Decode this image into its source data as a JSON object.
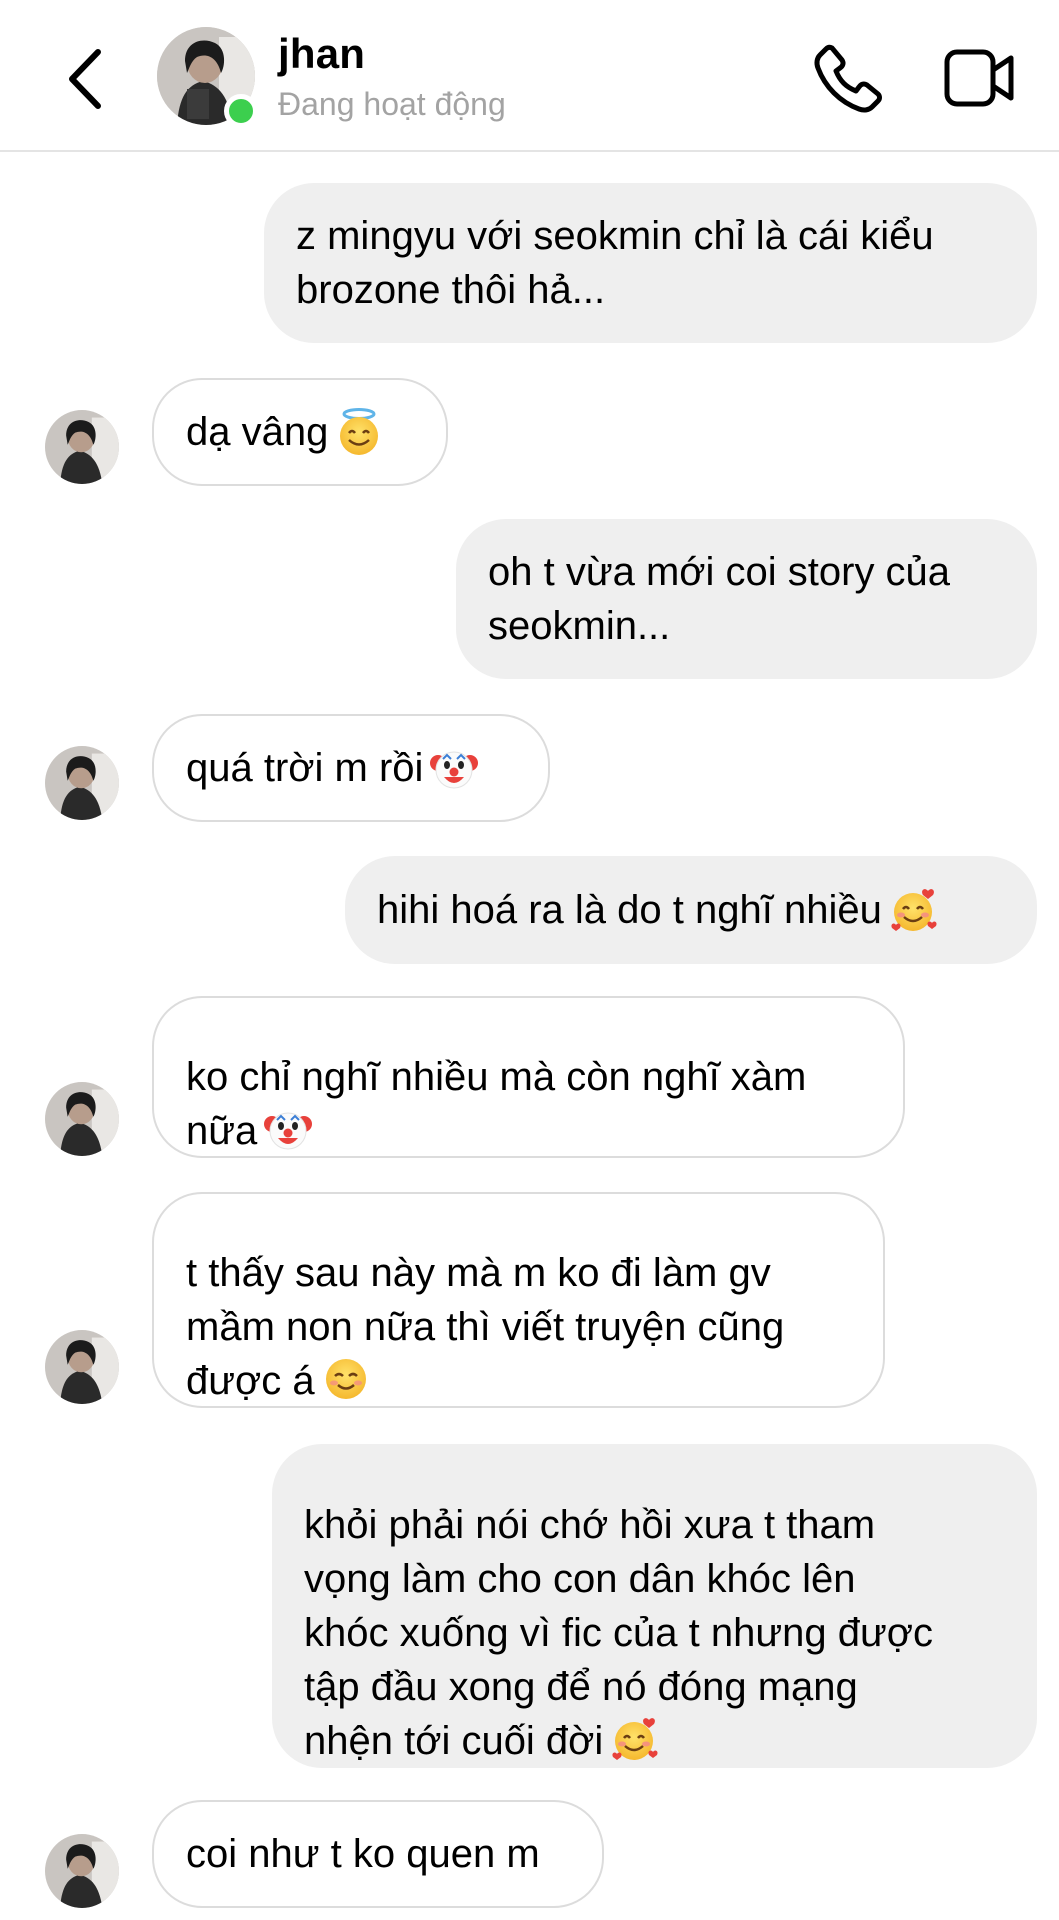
{
  "header": {
    "contact_name": "jhan",
    "contact_status": "Đang hoạt động",
    "back_icon": "chevron-left-icon",
    "call_icon": "phone-icon",
    "video_icon": "video-camera-icon",
    "online_color": "#3ccf4e"
  },
  "messages": [
    {
      "direction": "outgoing",
      "text": "z mingyu với seokmin chỉ là cái kiểu\nbrozone thôi hả..."
    },
    {
      "direction": "incoming",
      "text": "dạ vâng",
      "emoji": "smiling-face-with-halo"
    },
    {
      "direction": "outgoing",
      "text": "oh t vừa mới coi story của\nseokmin..."
    },
    {
      "direction": "incoming",
      "text": "quá trời m rồi",
      "emoji": "clown-face"
    },
    {
      "direction": "outgoing",
      "text": "hihi hoá ra là do t nghĩ nhiều",
      "emoji": "smiling-face-with-hearts"
    },
    {
      "direction": "incoming",
      "text": "ko chỉ nghĩ nhiều mà còn nghĩ xàm\nnữa",
      "emoji": "clown-face"
    },
    {
      "direction": "incoming",
      "text": "t thấy sau này mà m ko đi làm gv\nmầm non nữa thì viết truyện cũng\nđược á",
      "emoji": "smiling-face"
    },
    {
      "direction": "outgoing",
      "text": "khỏi phải nói chớ hồi xưa t tham\nvọng làm cho con dân khóc lên\nkhóc xuống vì fic của t nhưng được\ntập đầu xong để nó đóng mạng\nnhện tới cuối đời",
      "emoji": "smiling-face-with-hearts"
    },
    {
      "direction": "incoming",
      "text": "coi như t ko quen m"
    }
  ],
  "colors": {
    "outgoing_bubble": "#efefef",
    "incoming_border": "#dcdcdc",
    "status_text": "#a3a3a3"
  }
}
